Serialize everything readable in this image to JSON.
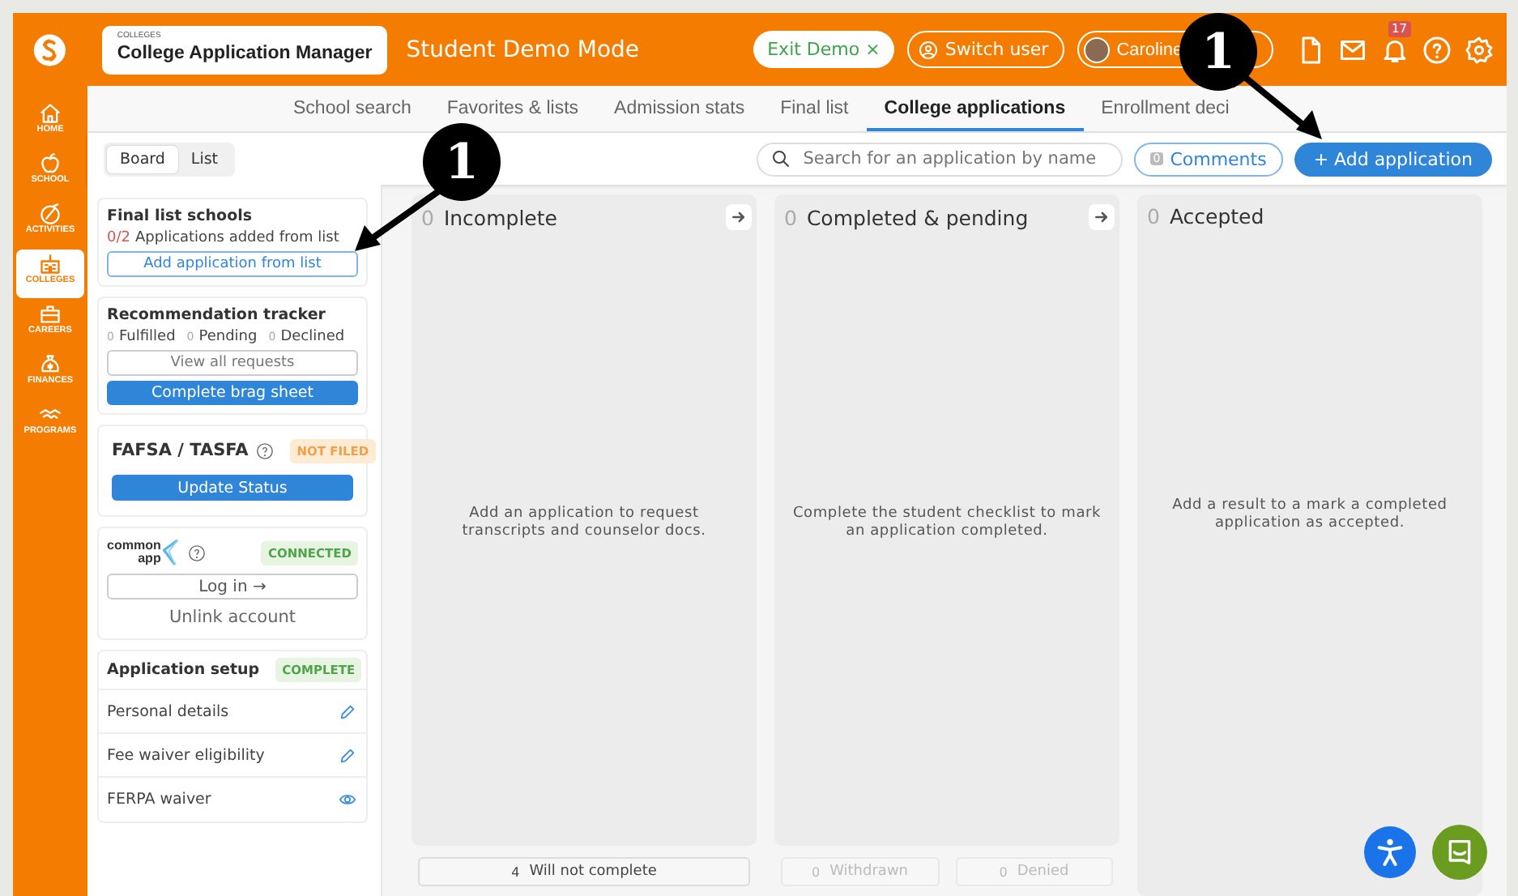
{
  "header": {
    "section": "COLLEGES",
    "title": "College Application Manager",
    "mode": "Student Demo Mode",
    "exit_button": "Exit Demo ×",
    "switch_button": "Switch user",
    "user_button": "Caroline",
    "notification_count": "17"
  },
  "sidebar": {
    "items": [
      {
        "label": "HOME",
        "selected": false
      },
      {
        "label": "SCHOOL",
        "selected": false
      },
      {
        "label": "ACTIVITIES",
        "selected": false
      },
      {
        "label": "COLLEGES",
        "selected": true
      },
      {
        "label": "CAREERS",
        "selected": false
      },
      {
        "label": "FINANCES",
        "selected": false
      },
      {
        "label": "PROGRAMS",
        "selected": false
      }
    ]
  },
  "tabs": [
    {
      "label": "School search",
      "selected": false
    },
    {
      "label": "Favorites & lists",
      "selected": false
    },
    {
      "label": "Admission stats",
      "selected": false
    },
    {
      "label": "Final list",
      "selected": false
    },
    {
      "label": "College applications",
      "selected": true
    },
    {
      "label": "Enrollment deci",
      "selected": false
    }
  ],
  "toolbar": {
    "views": [
      {
        "label": "Board",
        "selected": true
      },
      {
        "label": "List",
        "selected": false
      }
    ],
    "search": {
      "placeholder": "Search for an application by name"
    },
    "comments": {
      "count": "0",
      "label": "Comments"
    },
    "add_button": "+ Add application"
  },
  "final_list": {
    "title": "Final list schools",
    "count": "0/2",
    "text": "Applications added from list",
    "button": "Add application from list"
  },
  "recommendations": {
    "title": "Recommendation tracker",
    "stats": [
      {
        "count": "0",
        "label": "Fulfilled"
      },
      {
        "count": "0",
        "label": "Pending"
      },
      {
        "count": "0",
        "label": "Declined"
      }
    ],
    "view_button": "View all requests",
    "brag_button": "Complete brag sheet"
  },
  "fafsa": {
    "title": "FAFSA / TASFA",
    "status": {
      "label": "NOT FILED",
      "kind": "warning"
    },
    "button": "Update Status"
  },
  "common_app": {
    "logo_top": "common",
    "logo_bottom": "app",
    "status": {
      "label": "CONNECTED",
      "kind": "success"
    },
    "login_button": "Log in →",
    "unlink": "Unlink account"
  },
  "application_setup": {
    "title": "Application setup",
    "status": {
      "label": "COMPLETE",
      "kind": "success"
    },
    "rows": [
      {
        "label": "Personal details",
        "kind": "edit"
      },
      {
        "label": "Fee waiver eligibility",
        "kind": "edit"
      },
      {
        "label": "FERPA waiver",
        "kind": "view"
      }
    ]
  },
  "board": {
    "columns": [
      {
        "count": "0",
        "title": "Incomplete",
        "has_move": true,
        "message": "Add an application to request transcripts and counselor docs.",
        "footer": [
          {
            "count": "4",
            "label": "Will not complete",
            "disabled": false
          }
        ]
      },
      {
        "count": "0",
        "title": "Completed & pending",
        "has_move": true,
        "message": "Complete the student checklist to mark an application completed.",
        "footer": [
          {
            "count": "0",
            "label": "Withdrawn",
            "disabled": true
          },
          {
            "count": "0",
            "label": "Denied",
            "disabled": true
          }
        ]
      },
      {
        "count": "0",
        "title": "Accepted",
        "has_move": false,
        "message": "Add a result to a mark a completed application as accepted."
      }
    ]
  },
  "annotations": [
    {
      "label": "1",
      "kind": "down_left"
    },
    {
      "label": "1",
      "kind": "down_right"
    }
  ]
}
